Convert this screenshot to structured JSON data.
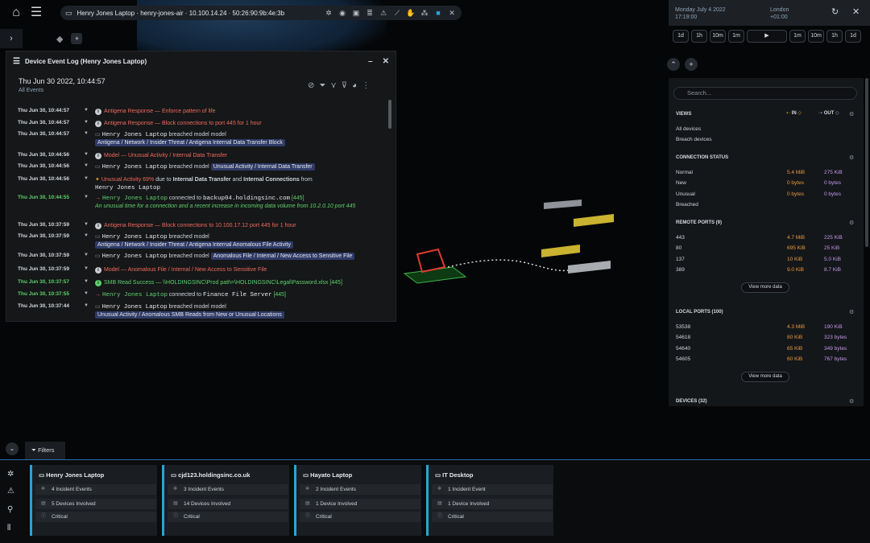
{
  "topbar": {
    "device_title": "Henry Jones Laptop · henry-jones-air · 10.100.14.24 · 50:26:90:9b:4e:3b"
  },
  "time": {
    "date": "Monday July 4 2022",
    "clock": "17:19:00",
    "city": "London",
    "offset": "+01:00",
    "controls": [
      "1d",
      "1h",
      "10m",
      "1m",
      "1m",
      "10m",
      "1h",
      "1d"
    ]
  },
  "log": {
    "title": "Device Event Log (Henry Jones Laptop)",
    "date": "Thu Jun 30 2022, 10:44:57",
    "subtitle": "All Events",
    "rows": [
      {
        "ts": "Thu Jun 30, 10:44:57",
        "a": "Antigena Response —",
        "b": "Enforce pattern of life"
      },
      {
        "ts": "Thu Jun 30, 10:44:57",
        "a": "Antigena Response —",
        "b": "Block connections to port 445 for 1 hour"
      },
      {
        "ts": "Thu Jun 30, 10:44:57",
        "dev": "Henry Jones Laptop",
        "verb": "breached model",
        "tag": "Antigena / Network / Insider Threat / Antigena Internal Data Transfer Block"
      },
      {
        "ts": "Thu Jun 30, 10:44:56",
        "a": "Model —",
        "b": "Unusual Activity / Internal Data Transfer"
      },
      {
        "ts": "Thu Jun 30, 10:44:56",
        "dev": "Henry Jones Laptop",
        "verb": "breached model",
        "tag": "Unusual Activity / Internal Data Transfer"
      },
      {
        "ts": "Thu Jun 30, 10:44:56",
        "a": "Unusual Activity 69%",
        "mid": "due to",
        "b1": "Internal Data Transfer",
        "and": "and",
        "b2": "Internal Connections",
        "from": "from",
        "dev": "Henry Jones Laptop"
      },
      {
        "ts": "Thu Jun 30, 10:44:55",
        "dev": "Henry Jones Laptop",
        "verb": "connected to",
        "target": "backup04.holdingsinc.com",
        "port": "[445]",
        "note": "An unusual time for a connection and a recent increase in incoming data volume from 10.2.0.10 port 445"
      },
      {
        "ts": "Thu Jun 30, 10:37:59",
        "a": "Antigena Response —",
        "b": "Block connections to 10.100.17.12 port 445 for 1 hour"
      },
      {
        "ts": "Thu Jun 30, 10:37:59",
        "dev": "Henry Jones Laptop",
        "verb": "breached model",
        "tag": "Antigena / Network / Insider Threat / Antigena Internal Anomalous File Activity"
      },
      {
        "ts": "Thu Jun 30, 10:37:59",
        "dev": "Henry Jones Laptop",
        "verb": "breached model",
        "tag": "Anomalous File / Internal / New Access to Sensitive File"
      },
      {
        "ts": "Thu Jun 30, 10:37:59",
        "a": "Model —",
        "b": "Anomalous File / Internal / New Access to Sensitive File"
      },
      {
        "ts": "Thu Jun 30, 10:37:57",
        "a": "SMB Read Success —",
        "b": "\\\\HOLDINGSINC\\Prod path=\\HOLDINGSINC\\Legal\\Password.xlsx",
        "port": "[445]"
      },
      {
        "ts": "Thu Jun 30, 10:37:55",
        "dev": "Henry Jones Laptop",
        "verb": "connected to",
        "target": "Finance File Server",
        "port": "[445]"
      },
      {
        "ts": "Thu Jun 30, 10:37:44",
        "dev": "Henry Jones Laptop",
        "verb": "breached model",
        "tag": "Unusual Activity / Anomalous SMB Reads from New or Unusual Locations"
      }
    ]
  },
  "side": {
    "search_placeholder": "Search...",
    "views": {
      "title": "VIEWS",
      "in": "IN",
      "out": "OUT",
      "items": [
        "All devices",
        "Breach devices"
      ]
    },
    "conn": {
      "title": "CONNECTION STATUS",
      "rows": [
        {
          "k": "Normal",
          "a": "5.4 MiB",
          "b": "275 KiB"
        },
        {
          "k": "New",
          "a": "0 bytes",
          "b": "0 bytes"
        },
        {
          "k": "Unusual",
          "a": "0 bytes",
          "b": "0 bytes"
        },
        {
          "k": "Breached",
          "a": "",
          "b": ""
        }
      ]
    },
    "remote": {
      "title": "REMOTE PORTS (9)",
      "rows": [
        {
          "k": "443",
          "a": "4.7 MiB",
          "b": "225 KiB"
        },
        {
          "k": "80",
          "a": "695 KiB",
          "b": "25 KiB"
        },
        {
          "k": "137",
          "a": "10 KiB",
          "b": "5.0 KiB"
        },
        {
          "k": "389",
          "a": "9.0 KiB",
          "b": "8.7 KiB"
        }
      ]
    },
    "local": {
      "title": "LOCAL PORTS (100)",
      "rows": [
        {
          "k": "53538",
          "a": "4.3 MiB",
          "b": "190 KiB"
        },
        {
          "k": "54618",
          "a": "80 KiB",
          "b": "323 bytes"
        },
        {
          "k": "54640",
          "a": "65 KiB",
          "b": "349 bytes"
        },
        {
          "k": "54605",
          "a": "60 KiB",
          "b": "767 bytes"
        }
      ]
    },
    "more": "View more data",
    "devices": "DEVICES (32)"
  },
  "bottom": {
    "filters": "Filters",
    "cards": [
      {
        "title": "Henry Jones Laptop",
        "events": "4 Incident Events",
        "devices": "5 Devices Involved",
        "severity": "Critical"
      },
      {
        "title": "cjd123.holdingsinc.co.uk",
        "events": "3 Incident Events",
        "devices": "14 Devices Involved",
        "severity": "Critical"
      },
      {
        "title": "Hayato Laptop",
        "events": "2 Incident Events",
        "devices": "1 Device Involved",
        "severity": "Critical"
      },
      {
        "title": "IT Desktop",
        "events": "1 Incident Event",
        "devices": "1 Device Involved",
        "severity": "Critical"
      }
    ]
  },
  "colors": {
    "accent": "#2ba3d6",
    "red": "#f06a5a",
    "green": "#5fd16a",
    "orange": "#e99a3c",
    "purple": "#c696e8"
  }
}
